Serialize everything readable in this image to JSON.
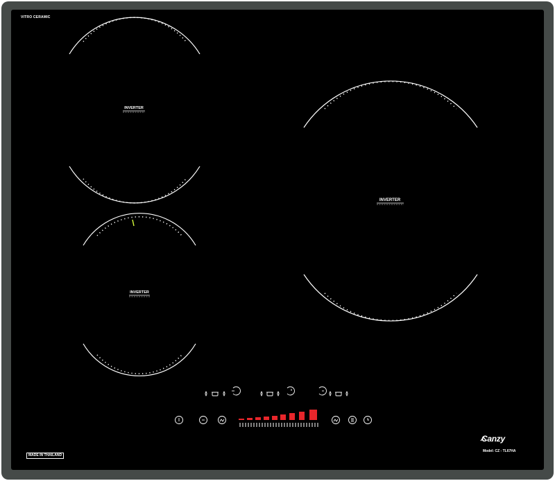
{
  "hob": {
    "surface_label": "VITRO CERAMIC",
    "origin_label": "MADE IN THAILAND",
    "brand": "Canzy",
    "model": "Model: CZ - TL67HA",
    "zones": [
      {
        "id": "top-left",
        "label": "INVERTER"
      },
      {
        "id": "bottom-left",
        "label": "INVERTER"
      },
      {
        "id": "right",
        "label": "INVERTER"
      }
    ],
    "colors": {
      "glass": "#000000",
      "frame": "#454a48",
      "ring": "#ffffff",
      "power_bar": "#e8262b",
      "indicator": "#d8ff3a"
    },
    "controls": {
      "top_row": [
        "burner-icon",
        "pot-icon",
        "flame-icon",
        "power-up-icon",
        "burner-icon",
        "pot-icon",
        "flame-icon",
        "power-up-icon",
        "power-up-icon",
        "burner-icon",
        "pot-icon",
        "flame-icon"
      ],
      "bottom_row": [
        "power-icon",
        "minus-icon",
        "boost-icon",
        "boost-icon",
        "pause-icon",
        "timer-icon"
      ],
      "power_levels": 9
    }
  }
}
